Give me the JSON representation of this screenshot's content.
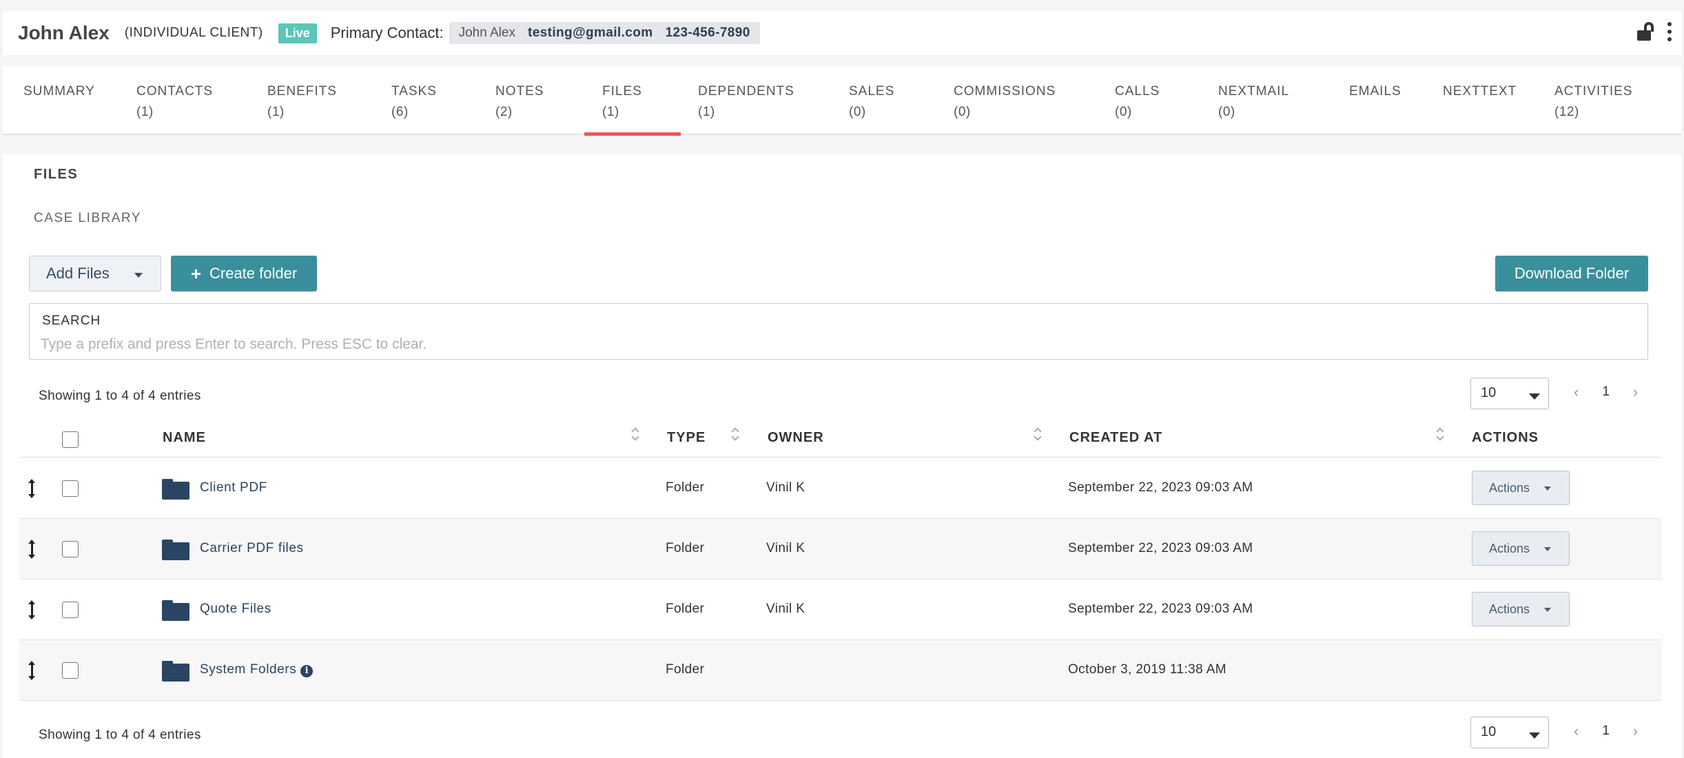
{
  "header": {
    "client_name": "John Alex",
    "client_type": "(INDIVIDUAL CLIENT)",
    "status_badge": "Live",
    "primary_contact_label": "Primary Contact:",
    "primary_contact": {
      "name": "John Alex",
      "email": "testing@gmail.com",
      "phone": "123-456-7890"
    }
  },
  "tabs": [
    {
      "label": "SUMMARY",
      "count": ""
    },
    {
      "label": "CONTACTS",
      "count": "(1)"
    },
    {
      "label": "BENEFITS",
      "count": "(1)"
    },
    {
      "label": "TASKS",
      "count": "(6)"
    },
    {
      "label": "NOTES",
      "count": "(2)"
    },
    {
      "label": "FILES",
      "count": "(1)"
    },
    {
      "label": "DEPENDENTS",
      "count": "(1)"
    },
    {
      "label": "SALES",
      "count": "(0)"
    },
    {
      "label": "COMMISSIONS",
      "count": "(0)"
    },
    {
      "label": "CALLS",
      "count": "(0)"
    },
    {
      "label": "NEXTMAIL",
      "count": "(0)"
    },
    {
      "label": "EMAILS",
      "count": ""
    },
    {
      "label": "NEXTTEXT",
      "count": ""
    },
    {
      "label": "ACTIVITIES",
      "count": "(12)"
    }
  ],
  "active_tab": "FILES",
  "files": {
    "section_title": "FILES",
    "case_library": "CASE LIBRARY",
    "add_files_label": "Add Files",
    "create_folder_label": "Create folder",
    "download_folder_label": "Download Folder",
    "search": {
      "label": "SEARCH",
      "placeholder": "Type a prefix and press Enter to search. Press ESC to clear."
    },
    "entries_text": "Showing 1 to 4 of 4 entries",
    "per_page": "10",
    "current_page": "1",
    "columns": {
      "name": "NAME",
      "type": "TYPE",
      "owner": "OWNER",
      "created_at": "CREATED AT",
      "actions": "ACTIONS"
    },
    "rows": [
      {
        "name": "Client PDF",
        "type": "Folder",
        "owner": "Vinil K",
        "created_at": "September 22, 2023 09:03 AM",
        "actions_label": "Actions"
      },
      {
        "name": "Carrier PDF files",
        "type": "Folder",
        "owner": "Vinil K",
        "created_at": "September 22, 2023 09:03 AM",
        "actions_label": "Actions"
      },
      {
        "name": "Quote Files",
        "type": "Folder",
        "owner": "Vinil K",
        "created_at": "September 22, 2023 09:03 AM",
        "actions_label": "Actions"
      },
      {
        "name": "System Folders",
        "type": "Folder",
        "owner": "",
        "created_at": "October 3, 2019 11:38 AM",
        "actions_label": ""
      }
    ]
  },
  "colors": {
    "accent_teal": "#3a8f9c",
    "live_badge": "#5bc6b8",
    "active_tab_bar": "#e35b5b",
    "folder": "#2a4563"
  }
}
